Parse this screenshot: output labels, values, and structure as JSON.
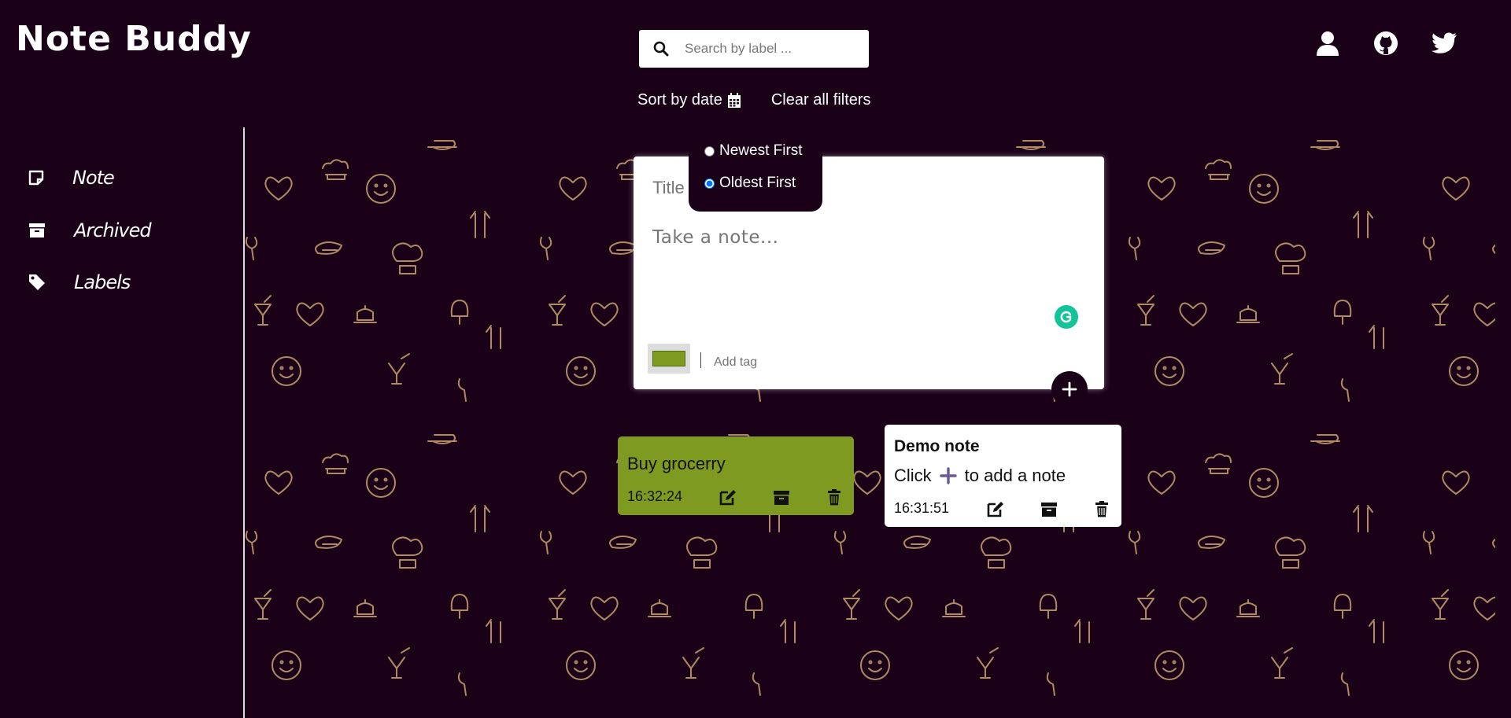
{
  "app": {
    "title": "Note Buddy"
  },
  "search": {
    "placeholder": "Search by label ..."
  },
  "header_icons": [
    "user-icon",
    "github-icon",
    "twitter-icon"
  ],
  "sortbar": {
    "sort_label": "Sort by date",
    "clear_label": "Clear all filters"
  },
  "sort_options": {
    "newest": "Newest First",
    "oldest": "Oldest First",
    "selected": "Oldest First"
  },
  "sidebar": {
    "items": [
      {
        "label": "Note",
        "icon": "sticky-note-icon"
      },
      {
        "label": "Archived",
        "icon": "archive-icon"
      },
      {
        "label": "Labels",
        "icon": "tag-icon"
      }
    ]
  },
  "editor": {
    "title_placeholder": "Title",
    "body_placeholder": "Take a note...",
    "tag_placeholder": "Add tag",
    "selected_color": "#7f9a20"
  },
  "notes": [
    {
      "title": "Buy grocerry",
      "time": "16:32:24",
      "color": "#7f9a20"
    },
    {
      "title": "Demo note",
      "body_before": "Click",
      "body_after": "to add a note",
      "time": "16:31:51",
      "color": "#ffffff"
    }
  ],
  "colors": {
    "background": "#1a0118",
    "pattern": "#b08a63",
    "accent": "#7f9a20"
  }
}
